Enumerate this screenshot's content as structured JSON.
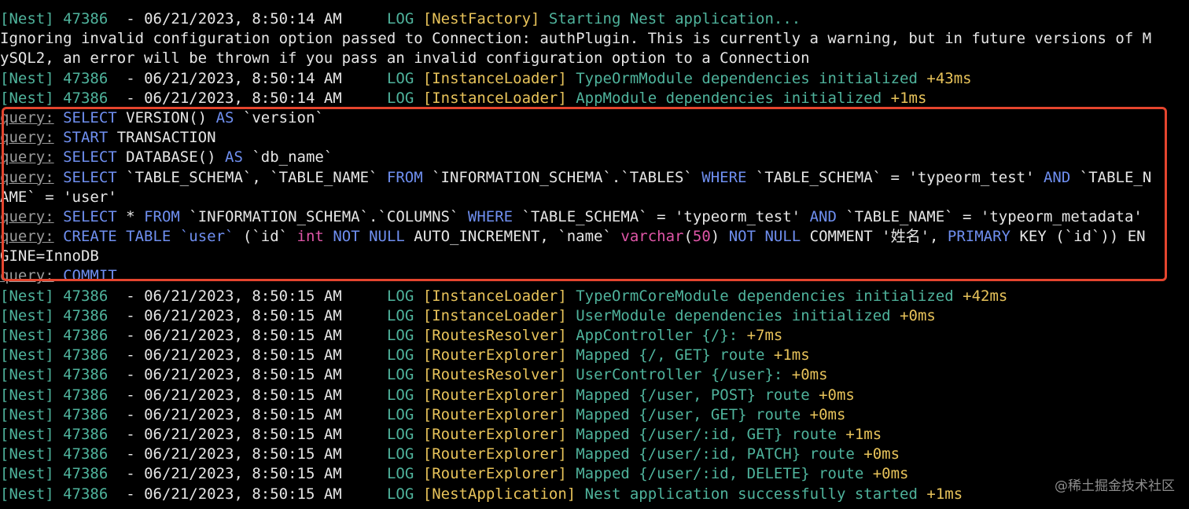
{
  "log_prefix": "[Nest]",
  "pid": "47386",
  "dash": "-",
  "level": "LOG",
  "timestamps": {
    "t14": "06/21/2023, 8:50:14 AM",
    "t15": "06/21/2023, 8:50:15 AM"
  },
  "lines": {
    "start": {
      "context": "[NestFactory]",
      "message": "Starting Nest application..."
    },
    "warning": [
      "Ignoring invalid configuration option passed to Connection: authPlugin. This is currently a warning, but in future versions of M",
      "ySQL2, an error will be thrown if you pass an invalid configuration option to a Connection"
    ],
    "typeorm_module": {
      "context": "[InstanceLoader]",
      "message": "TypeOrmModule dependencies initialized",
      "duration": "+43ms"
    },
    "app_module": {
      "context": "[InstanceLoader]",
      "message": "AppModule dependencies initialized",
      "duration": "+1ms"
    },
    "typeorm_core": {
      "context": "[InstanceLoader]",
      "message": "TypeOrmCoreModule dependencies initialized",
      "duration": "+42ms"
    },
    "user_module": {
      "context": "[InstanceLoader]",
      "message": "UserModule dependencies initialized",
      "duration": "+0ms"
    },
    "app_controller": {
      "context": "[RoutesResolver]",
      "message": "AppController {/}:",
      "duration": "+7ms"
    },
    "route_root_get": {
      "context": "[RouterExplorer]",
      "message": "Mapped {/, GET} route",
      "duration": "+1ms"
    },
    "user_controller": {
      "context": "[RoutesResolver]",
      "message": "UserController {/user}:",
      "duration": "+0ms"
    },
    "route_user_post": {
      "context": "[RouterExplorer]",
      "message": "Mapped {/user, POST} route",
      "duration": "+0ms"
    },
    "route_user_get": {
      "context": "[RouterExplorer]",
      "message": "Mapped {/user, GET} route",
      "duration": "+0ms"
    },
    "route_user_id_get": {
      "context": "[RouterExplorer]",
      "message": "Mapped {/user/:id, GET} route",
      "duration": "+1ms"
    },
    "route_user_id_patch": {
      "context": "[RouterExplorer]",
      "message": "Mapped {/user/:id, PATCH} route",
      "duration": "+0ms"
    },
    "route_user_id_delete": {
      "context": "[RouterExplorer]",
      "message": "Mapped {/user/:id, DELETE} route",
      "duration": "+0ms"
    },
    "app_started": {
      "context": "[NestApplication]",
      "message": "Nest application successfully started",
      "duration": "+1ms"
    }
  },
  "queries": {
    "label": "query:",
    "q1": {
      "kw1": "SELECT",
      "p1": " VERSION() ",
      "kw2": "AS",
      "p2": " `version`"
    },
    "q2": {
      "kw1": "START",
      "p1": " TRANSACTION"
    },
    "q3": {
      "kw1": "SELECT",
      "p1": " DATABASE() ",
      "kw2": "AS",
      "p2": " `db_name`"
    },
    "q4": {
      "kw1": "SELECT",
      "p1": " `TABLE_SCHEMA`, `TABLE_NAME` ",
      "kw2": "FROM",
      "p2": " `INFORMATION_SCHEMA`.`TABLES` ",
      "kw3": "WHERE",
      "p3": " `TABLE_SCHEMA` = 'typeorm_test' ",
      "kw4": "AND",
      "p4": " `TABLE_N",
      "cont": "AME` = 'user'"
    },
    "q5": {
      "kw1": "SELECT",
      "p1": " * ",
      "kw2": "FROM",
      "p2": " `INFORMATION_SCHEMA`.`COLUMNS` ",
      "kw3": "WHERE",
      "p3": " `TABLE_SCHEMA` = 'typeorm_test' ",
      "kw4": "AND",
      "p4": " `TABLE_NAME` = 'typeorm_metadata'"
    },
    "q6": {
      "kw1": "CREATE TABLE",
      "kw1b": " `user` ",
      "p1": "(`id` ",
      "ty1": "int",
      "p2": " ",
      "kw2": "NOT NULL",
      "p3": " AUTO_INCREMENT, `name` ",
      "ty2": "varchar",
      "p4": "(",
      "num": "50",
      "p5": ") ",
      "kw3": "NOT NULL",
      "p6": " COMMENT '姓名', ",
      "kw4": "PRIMARY",
      "p7": " KEY (`id`)) EN",
      "cont": "GINE=InnoDB"
    },
    "q7": {
      "kw1": "COMMIT"
    }
  },
  "watermark": "@稀土掘金技术社区",
  "colors": {
    "background": "#000000",
    "green": "#4fb39c",
    "yellow": "#e8c35a",
    "keyword_blue": "#6f8ff0",
    "type_pink": "#e056a8",
    "highlight_red": "#e5452e"
  }
}
